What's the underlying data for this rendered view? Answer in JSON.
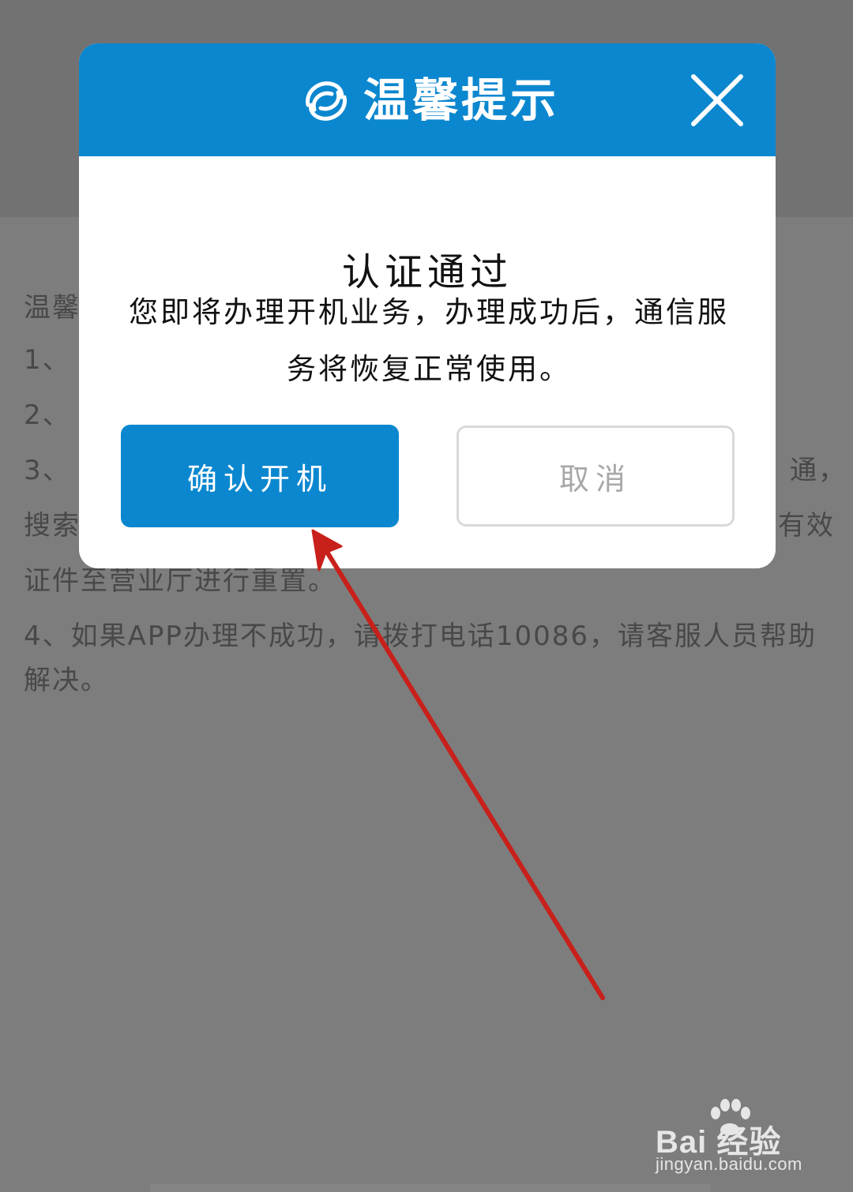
{
  "background_page": {
    "tips_title": "温馨",
    "tips": [
      "1、",
      "2、",
      "3、",
      "搜索",
      "证件至营业厅进行重置。",
      "4、如果APP办理不成功，请拨打电话10086，请客服人员帮助解决。"
    ],
    "tips_right_fragments": [
      "通，",
      "有效"
    ]
  },
  "modal": {
    "header_title": "温馨提示",
    "logo_icon": "china-mobile-logo-icon",
    "close_icon": "close-icon",
    "title": "认证通过",
    "message": "您即将办理开机业务，办理成功后，通信服务将恢复正常使用。",
    "confirm_label": "确认开机",
    "cancel_label": "取消"
  },
  "watermark": {
    "brand": "Bai  经验",
    "url": "jingyan.baidu.com"
  },
  "colors": {
    "accent": "#0b87cf",
    "overlay": "#7d7d7d",
    "arrow": "#c8201b"
  }
}
